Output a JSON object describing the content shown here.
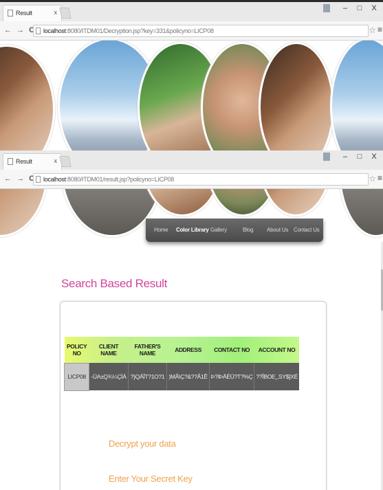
{
  "browser_top": {
    "tab_title": "Result",
    "tab_close": "x",
    "url_host": "localhost",
    "url_rest": ":8080/ITDM01/Decryption.jsp?key=331&policyno=LICP08",
    "window_minimize": "–",
    "window_maximize": "□",
    "window_close": "X"
  },
  "browser_bottom": {
    "tab_title": "Result",
    "tab_close": "x",
    "url_host": "localhost",
    "url_rest": ":8080/ITDM01/result.jsp?policyno=LICP08",
    "window_minimize": "–",
    "window_maximize": "□",
    "window_close": "X"
  },
  "nav": {
    "back": "←",
    "forward": "→",
    "reload": "C",
    "star": "☆",
    "menu": "≡"
  },
  "menu": {
    "items": [
      "Home",
      "Color Library",
      "Gallery",
      "Blog",
      "About Us",
      "Contact Us"
    ],
    "active_index": 1
  },
  "content": {
    "heading": "Search Based Result",
    "table": {
      "columns": [
        "POLICY NO",
        "CLIENT NAME",
        "FATHER'S NAME",
        "ADDRESS",
        "CONTACT NO",
        "ACCOUNT NO"
      ],
      "rows": [
        [
          "LICP08",
          "-ÜA±Q¾¼ÇÌÁ",
          "?}QÄÎT?1O?1",
          ")MÂ\\Ç?&??Â1Ê",
          "Þ?IÞÄÉÜ?T?%Ç",
          "??ÎBOE¸,SY$]XÉ"
        ]
      ]
    },
    "decrypt_link": "Decrypt your data",
    "secret_key_link": "Enter Your Secret Key"
  },
  "colors": {
    "heading": "#d2459b",
    "link": "#f0a050",
    "menu_bg": "#555555",
    "header_gradient_start": "#e8f970",
    "header_gradient_end": "#a2f07a"
  }
}
